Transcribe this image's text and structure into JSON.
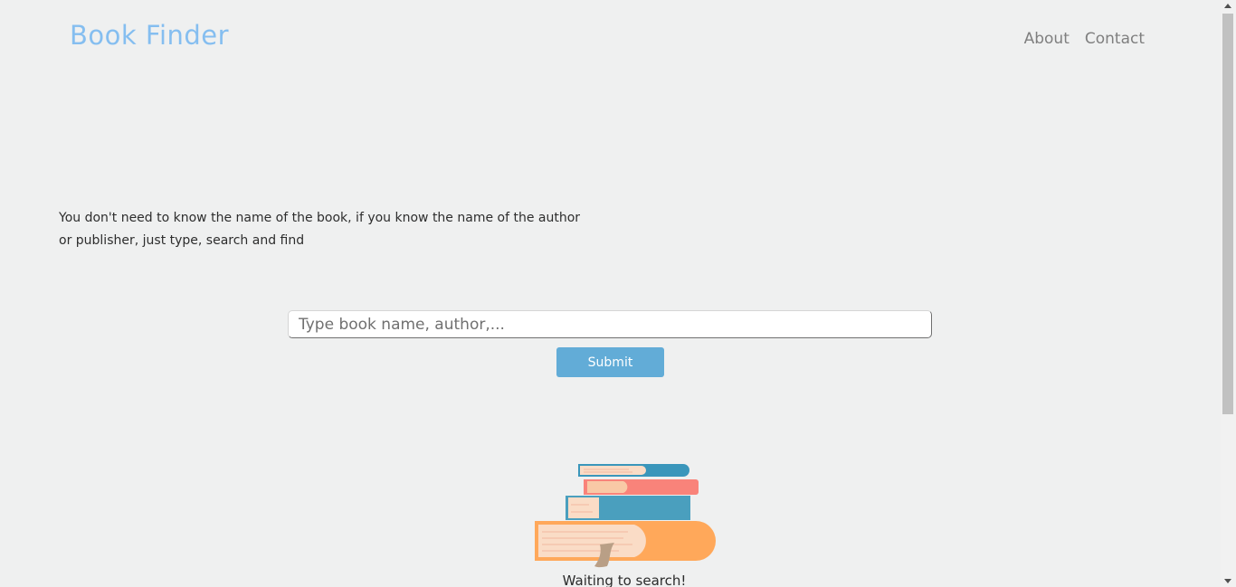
{
  "header": {
    "logo": "Book Finder",
    "nav": [
      {
        "label": "About"
      },
      {
        "label": "Contact"
      }
    ]
  },
  "intro": {
    "line1": "You don't need to know the name of the book, if you know the name of the author",
    "line2": "or publisher, just type, search and find"
  },
  "search": {
    "placeholder": "Type book name, author,...",
    "value": "",
    "submit_label": "Submit"
  },
  "illustration": {
    "icon": "stack-of-books-icon"
  },
  "status": {
    "text": "Waiting to search!"
  },
  "colors": {
    "logo": "#85bef0",
    "accent": "#62acd7",
    "background": "#eff0f0"
  }
}
